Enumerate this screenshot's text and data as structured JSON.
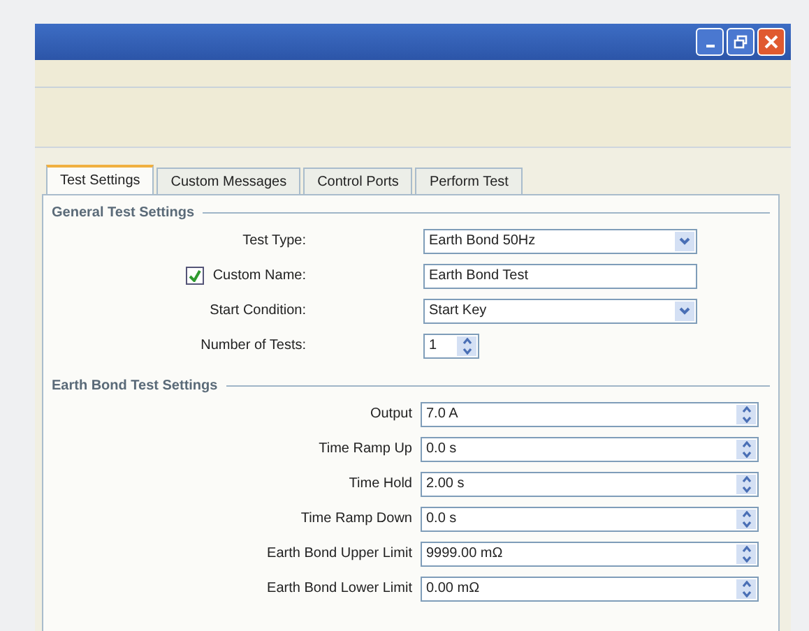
{
  "tabs": [
    {
      "label": "Test Settings",
      "selected": true
    },
    {
      "label": "Custom Messages",
      "selected": false
    },
    {
      "label": "Control Ports",
      "selected": false
    },
    {
      "label": "Perform Test",
      "selected": false
    }
  ],
  "general": {
    "title": "General Test Settings",
    "rows": [
      {
        "kind": "select",
        "label": "Test Type:",
        "value": "Earth Bond 50Hz"
      },
      {
        "kind": "text",
        "label": "Custom Name:",
        "value": "Earth Bond Test",
        "checked": true
      },
      {
        "kind": "select",
        "label": "Start Condition:",
        "value": "Start Key"
      },
      {
        "kind": "spinner",
        "label": "Number of Tests:",
        "value": "1"
      }
    ]
  },
  "earth_bond": {
    "title": "Earth Bond Test Settings",
    "rows": [
      {
        "label": "Output",
        "value": "7.0 A"
      },
      {
        "label": "Time Ramp Up",
        "value": "0.0 s"
      },
      {
        "label": "Time Hold",
        "value": "2.00 s"
      },
      {
        "label": "Time Ramp Down",
        "value": "0.0 s"
      },
      {
        "label": "Earth Bond Upper Limit",
        "value": "9999.00 mΩ"
      },
      {
        "label": "Earth Bond Lower Limit",
        "value": "0.00 mΩ"
      }
    ]
  }
}
